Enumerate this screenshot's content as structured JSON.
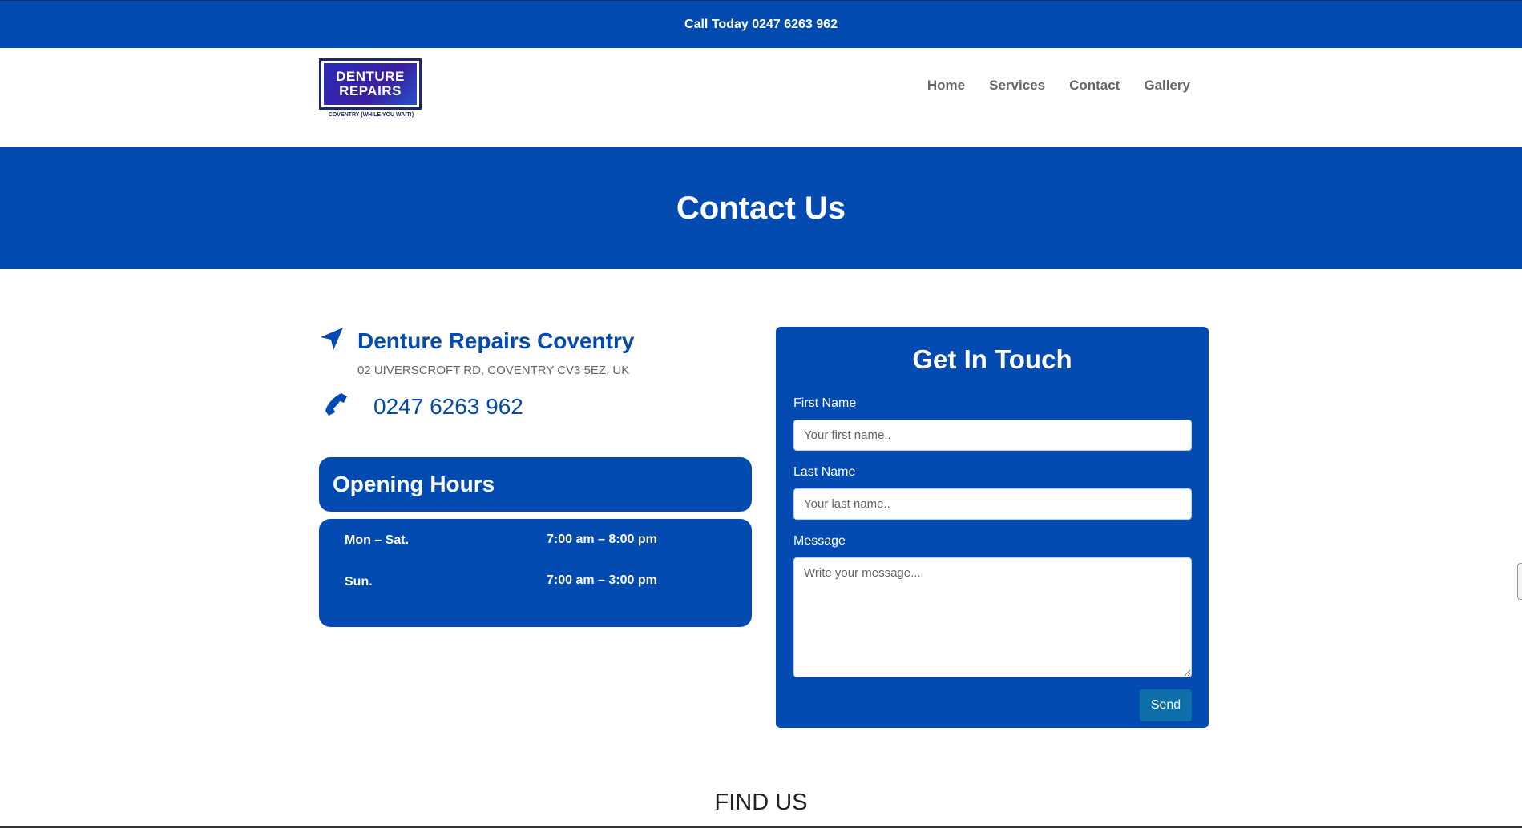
{
  "topbar": {
    "text": "Call Today 0247 6263 962"
  },
  "header": {
    "logo": {
      "line1": "DENTURE",
      "line2": "REPAIRS",
      "tagline": "COVENTRY (WHILE YOU WAIT!)"
    },
    "nav": [
      "Home",
      "Services",
      "Contact",
      "Gallery"
    ]
  },
  "hero": {
    "title": "Contact Us"
  },
  "location": {
    "icon": "location-arrow-icon",
    "name": "Denture Repairs Coventry",
    "address": "02 UIVERSCROFT RD, COVENTRY CV3 5EZ, UK"
  },
  "phone": {
    "icon": "phone-icon",
    "number": "0247 6263 962"
  },
  "hours": {
    "title": "Opening Hours",
    "rows": [
      {
        "day": "Mon – Sat.",
        "time": "7:00 am – 8:00 pm"
      },
      {
        "day": "Sun.",
        "time": "7:00 am – 3:00 pm"
      }
    ]
  },
  "form": {
    "title": "Get In Touch",
    "first_name_label": "First Name",
    "first_name_placeholder": "Your first name..",
    "last_name_label": "Last Name",
    "last_name_placeholder": "Your last name..",
    "message_label": "Message",
    "message_placeholder": "Write your message...",
    "send_label": "Send"
  },
  "find_us": {
    "title": "FIND US"
  },
  "colors": {
    "brand_blue": "#034bb0",
    "send_button": "#0d6ea8"
  }
}
